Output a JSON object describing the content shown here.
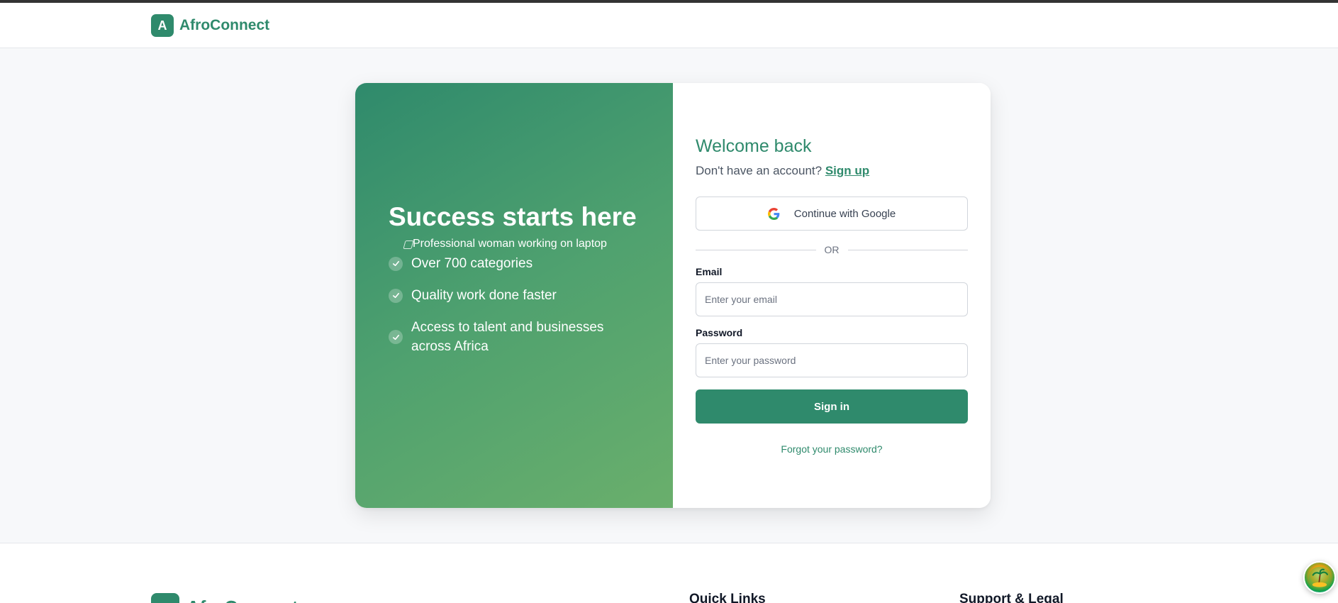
{
  "header": {
    "logo_letter": "A",
    "brand": "AfroConnect"
  },
  "hero": {
    "title": "Success starts here",
    "image_alt": "Professional woman working on laptop",
    "features": [
      "Over 700 categories",
      "Quality work done faster",
      "Access to talent and businesses across Africa"
    ]
  },
  "form": {
    "title": "Welcome back",
    "signup_prompt": "Don't have an account?",
    "signup_link": "Sign up",
    "google_label": "Continue with Google",
    "divider": "OR",
    "email_label": "Email",
    "email_placeholder": "Enter your email",
    "password_label": "Password",
    "password_placeholder": "Enter your password",
    "submit_label": "Sign in",
    "forgot_label": "Forgot your password?"
  },
  "footer": {
    "brand": "AfroConnect",
    "quick_links_heading": "Quick Links",
    "support_heading": "Support & Legal"
  },
  "colors": {
    "brand": "#2f8a6c",
    "gradient_end": "#6aaf6c"
  },
  "icons": {
    "check": "check-icon",
    "google": "google-icon",
    "assistant": "assistant-avatar-icon"
  }
}
